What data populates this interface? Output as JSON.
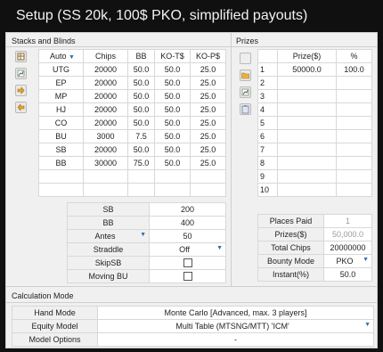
{
  "title": "Setup (SS 20k, 100$ PKO, simplified payouts)",
  "stacks": {
    "group_label": "Stacks and Blinds",
    "headers": [
      "Auto",
      "Chips",
      "BB",
      "KO-T$",
      "KO-P$"
    ],
    "rows": [
      [
        "UTG",
        "20000",
        "50.0",
        "50.0",
        "25.0"
      ],
      [
        "EP",
        "20000",
        "50.0",
        "50.0",
        "25.0"
      ],
      [
        "MP",
        "20000",
        "50.0",
        "50.0",
        "25.0"
      ],
      [
        "HJ",
        "20000",
        "50.0",
        "50.0",
        "25.0"
      ],
      [
        "CO",
        "20000",
        "50.0",
        "50.0",
        "25.0"
      ],
      [
        "BU",
        "3000",
        "7.5",
        "50.0",
        "25.0"
      ],
      [
        "SB",
        "20000",
        "50.0",
        "50.0",
        "25.0"
      ],
      [
        "BB",
        "30000",
        "75.0",
        "50.0",
        "25.0"
      ]
    ],
    "tool_icons": [
      "table-icon",
      "chart-icon",
      "arrow-right-icon",
      "arrow-left-icon"
    ]
  },
  "blinds": {
    "sb_label": "SB",
    "sb_value": "200",
    "bb_label": "BB",
    "bb_value": "400",
    "antes_label": "Antes",
    "antes_value": "50",
    "straddle_label": "Straddle",
    "straddle_value": "Off",
    "skipsb_label": "SkipSB",
    "skipsb_checked": false,
    "movingbu_label": "Moving BU",
    "movingbu_checked": false
  },
  "prizes": {
    "group_label": "Prizes",
    "headers": [
      "Prize($)",
      "%"
    ],
    "rows": [
      [
        "1",
        "50000.0",
        "100.0"
      ],
      [
        "2",
        "",
        ""
      ],
      [
        "3",
        "",
        ""
      ],
      [
        "4",
        "",
        ""
      ],
      [
        "5",
        "",
        ""
      ],
      [
        "6",
        "",
        ""
      ],
      [
        "7",
        "",
        ""
      ],
      [
        "8",
        "",
        ""
      ],
      [
        "9",
        "",
        ""
      ],
      [
        "10",
        "",
        ""
      ]
    ],
    "tool_icons": [
      "open-folder-icon",
      "chart-icon",
      "table-icon",
      "clipboard-icon"
    ]
  },
  "summary": {
    "places_paid_label": "Places Paid",
    "places_paid_value": "1",
    "prizes_label": "Prizes($)",
    "prizes_value": "50,000.0",
    "total_chips_label": "Total Chips",
    "total_chips_value": "20000000",
    "bounty_mode_label": "Bounty Mode",
    "bounty_mode_value": "PKO",
    "instant_label": "Instant(%)",
    "instant_value": "50.0"
  },
  "calc": {
    "group_label": "Calculation Mode",
    "hand_mode_label": "Hand Mode",
    "hand_mode_value": "Monte Carlo [Advanced, max. 3 players]",
    "equity_model_label": "Equity Model",
    "equity_model_value": "Multi Table (MTSNG/MTT) 'ICM'",
    "model_options_label": "Model Options",
    "model_options_value": "-"
  },
  "colors": {
    "accent_arrow": "#2f6fb5",
    "background": "#101010",
    "panel": "#f0f0f0"
  }
}
